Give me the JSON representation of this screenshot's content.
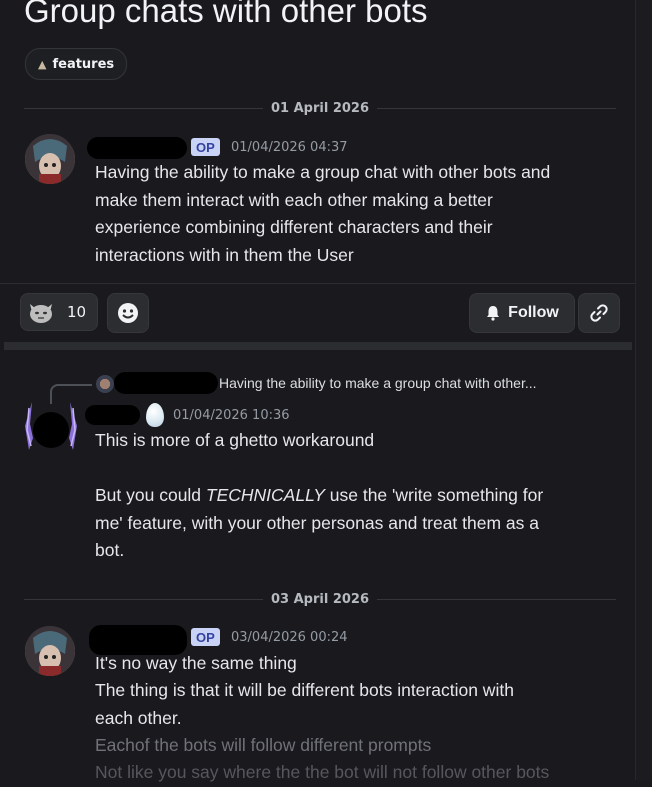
{
  "thread": {
    "title": "Group chats with other bots",
    "tag": "features",
    "tag_icon": "rocket-icon"
  },
  "dates": {
    "first": "01 April 2026",
    "second": "03 April 2026"
  },
  "posts": [
    {
      "op_badge": "OP",
      "timestamp": "01/04/2026 04:37",
      "lines": [
        "Having the ability to make a group chat with other bots and",
        "make them interact with each other making a better",
        "experience combining different characters and their",
        "interactions with in them the User"
      ]
    },
    {
      "reply_to": "Having the ability to make a group chat with other...",
      "timestamp": "01/04/2026 10:36",
      "line1": "This is more of a ghetto workaround",
      "line2_pre": "But you could ",
      "line2_em": "TECHNICALLY",
      "line2_post": " use the 'write something for",
      "line3": "me' feature, with your other personas and treat them as a",
      "line4": "bot."
    },
    {
      "op_badge": "OP",
      "timestamp": "03/04/2026 00:24",
      "lines": [
        "It's no way the same thing",
        "The thing is that it will be different bots interaction with",
        "each other.",
        "Eachof the bots will follow different prompts",
        "Not like you say where the the bot will not follow other bots"
      ]
    }
  ],
  "actions": {
    "reaction_count": "10",
    "follow_label": "Follow"
  },
  "colors": {
    "background": "#1a1a1e",
    "op_badge_bg": "#c9d3f5",
    "op_badge_text": "#3442a0"
  }
}
